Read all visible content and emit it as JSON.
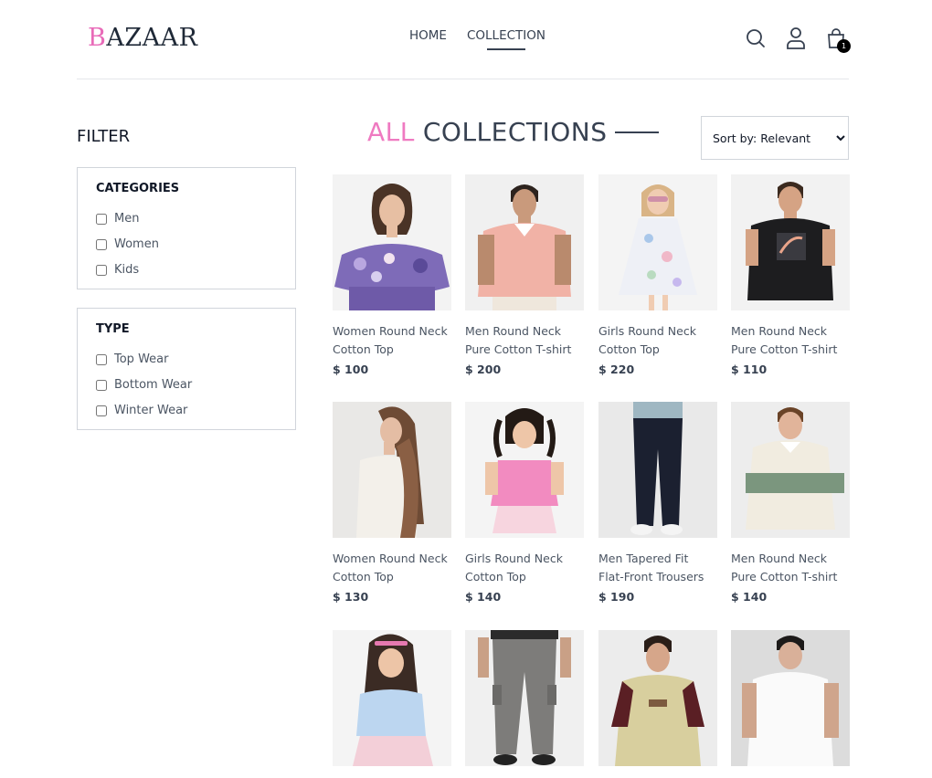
{
  "brand": {
    "first": "B",
    "rest": "AZAAR"
  },
  "nav": [
    {
      "label": "HOME"
    },
    {
      "label": "COLLECTION"
    }
  ],
  "cart": {
    "count": "1"
  },
  "filter": {
    "title": "FILTER",
    "categories": {
      "heading": "CATEGORIES",
      "options": [
        "Men",
        "Women",
        "Kids"
      ]
    },
    "type": {
      "heading": "TYPE",
      "options": [
        "Top Wear",
        "Bottom Wear",
        "Winter Wear"
      ]
    }
  },
  "collection": {
    "title_accent": "ALL",
    "title_rest": "COLLECTIONS"
  },
  "sort": {
    "selected": "Sort by: Relevant"
  },
  "products": [
    {
      "name": "Women Round Neck Cotton Top",
      "price": "$ 100"
    },
    {
      "name": "Men Round Neck Pure Cotton T-shirt",
      "price": "$ 200"
    },
    {
      "name": "Girls Round Neck Cotton Top",
      "price": "$ 220"
    },
    {
      "name": "Men Round Neck Pure Cotton T-shirt",
      "price": "$ 110"
    },
    {
      "name": "Women Round Neck Cotton Top",
      "price": "$ 130"
    },
    {
      "name": "Girls Round Neck Cotton Top",
      "price": "$ 140"
    },
    {
      "name": "Men Tapered Fit Flat-Front Trousers",
      "price": "$ 190"
    },
    {
      "name": "Men Round Neck Pure Cotton T-shirt",
      "price": "$ 140"
    },
    {
      "name": "",
      "price": ""
    },
    {
      "name": "",
      "price": ""
    },
    {
      "name": "",
      "price": ""
    },
    {
      "name": "",
      "price": ""
    }
  ]
}
